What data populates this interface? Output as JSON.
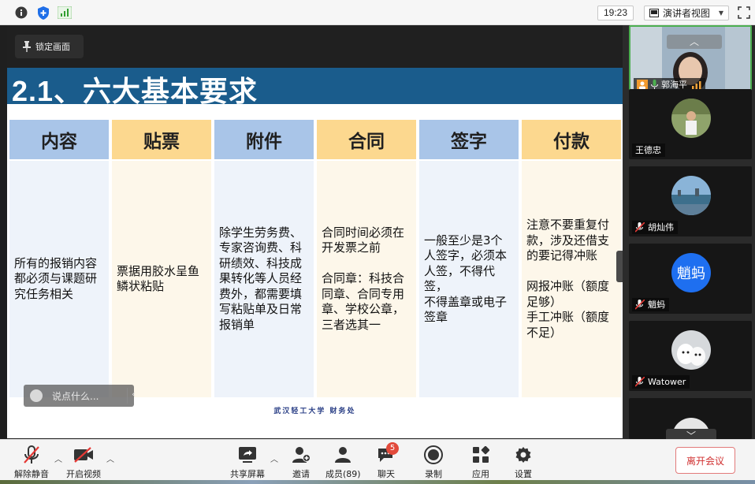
{
  "topbar": {
    "clock": "19:23",
    "view_label": "演讲者视图"
  },
  "share": {
    "lock_label": "锁定画面",
    "chat_placeholder": "说点什么...",
    "slide": {
      "title": "2.1、六大基本要求",
      "footer": "武汉轻工大学 财务处",
      "columns": [
        {
          "header": "内容",
          "body": "所有的报销内容\n都必须与课题研\n究任务相关"
        },
        {
          "header": "贴票",
          "body": "票据用胶水呈鱼\n鳞状粘贴"
        },
        {
          "header": "附件",
          "body": "除学生劳务费、\n专家咨询费、科\n研绩效、科技成\n果转化等人员经\n费外，都需要填\n写粘贴单及日常\n报销单"
        },
        {
          "header": "合同",
          "body": "合同时间必须在\n开发票之前\n\n合同章：科技合\n同章、合同专用\n章、学校公章，\n三者选其一"
        },
        {
          "header": "签字",
          "body": "一般至少是3个\n人签字，必须本\n人签，不得代签，\n不得盖章或电子\n签章"
        },
        {
          "header": "付款",
          "body": "注意不要重复付\n款，涉及还借支\n的要记得冲账\n\n网报冲账（额度\n足够）\n手工冲账（额度\n不足）"
        }
      ]
    }
  },
  "participants": [
    {
      "name": "郭海平"
    },
    {
      "name": "王德忠"
    },
    {
      "name": "胡灿伟"
    },
    {
      "name": "魈蚂",
      "avatar_text": "魈蚂"
    },
    {
      "name": "Watower"
    }
  ],
  "toolbar": {
    "unmute": "解除静音",
    "start_video": "开启视频",
    "share_screen": "共享屏幕",
    "invite": "邀请",
    "members": "成员(89)",
    "chat": "聊天",
    "chat_badge": "5",
    "record": "录制",
    "apps": "应用",
    "settings": "设置",
    "leave": "离开会议"
  },
  "colors": {
    "title_bar": "#1a5c8c",
    "header_blue": "#a9c5e8",
    "header_gold": "#fcd88f",
    "avatar_blue": "#1e6ff0",
    "leave_red": "#d03030"
  }
}
